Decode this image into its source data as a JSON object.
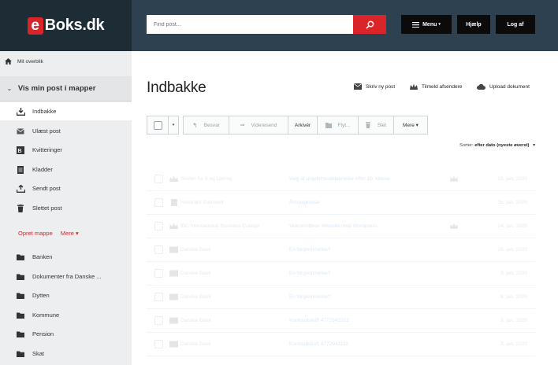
{
  "brand": {
    "logo_letter": "e",
    "logo_text": "Boks.dk"
  },
  "search": {
    "placeholder": "Find post..."
  },
  "topnav": {
    "menu_label": "Menu",
    "help_label": "Hjælp",
    "logout_label": "Log af"
  },
  "sidebar": {
    "overview_label": "Mit overblik",
    "vis_label": "Vis min post i mapper",
    "items": [
      {
        "label": "Indbakke",
        "icon": "inbox-icon"
      },
      {
        "label": "Ulæst post",
        "icon": "envelope-icon"
      },
      {
        "label": "Kvitteringer",
        "icon": "receipt-icon"
      },
      {
        "label": "Kladder",
        "icon": "draft-icon"
      },
      {
        "label": "Sendt post",
        "icon": "sent-icon"
      },
      {
        "label": "Slettet post",
        "icon": "trash-icon"
      }
    ],
    "create_folder": "Opret mappe",
    "more": "Mere ▾",
    "folders": [
      "Banken",
      "Dokumenter fra Danske ...",
      "Dytten",
      "Kommune",
      "Pension",
      "Skat"
    ]
  },
  "main": {
    "title": "Indbakke",
    "actions": {
      "write": "Skriv ny post",
      "subscribe": "Tilmeld afsendere",
      "upload": "Upload dokument"
    },
    "toolbar": {
      "reply": "Besvar",
      "forward": "Videresend",
      "archive": "Arkivér",
      "move": "Flyt...",
      "delete": "Slet",
      "more": "Mere ▾"
    },
    "sort_prefix": "Sorter:",
    "sort_value": "efter dato (nyeste øverst)",
    "messages": [
      {
        "sender": "Skolen for 9 og Læring",
        "subject": "Valg af ungdomsuddannelse efter 10. klasse",
        "date": "15. jan. 2020",
        "attachment": true
      },
      {
        "sender": "Hosbrødt Danmark",
        "subject": "Årsopgørelse",
        "date": "15. jan. 2020",
        "attachment": false
      },
      {
        "sender": "IBC International Business College",
        "subject": "Velkomstbrev Website med Wordpress",
        "date": "14. jan. 2020",
        "attachment": true
      },
      {
        "sender": "Danske Bank",
        "subject": "En forglemmelse?",
        "date": "10. jan. 2020",
        "attachment": false
      },
      {
        "sender": "Danske Bank",
        "subject": "En forglemmelse?",
        "date": "9. jan. 2020",
        "attachment": false
      },
      {
        "sender": "Danske Bank",
        "subject": "En forglemmelse?",
        "date": "8. jan. 2020",
        "attachment": false
      },
      {
        "sender": "Danske Bank",
        "subject": "Kontoudskrift 4772943202",
        "date": "3. jan. 2020",
        "attachment": false
      },
      {
        "sender": "Danske Bank",
        "subject": "Kontoudskrift 4772941192",
        "date": "3. jan. 2020",
        "attachment": false
      }
    ]
  },
  "colors": {
    "brand_red": "#d9252a",
    "topbar_dark": "#1e2c36",
    "topbar": "#2e4150",
    "sidebar_bg": "#eceeef"
  }
}
